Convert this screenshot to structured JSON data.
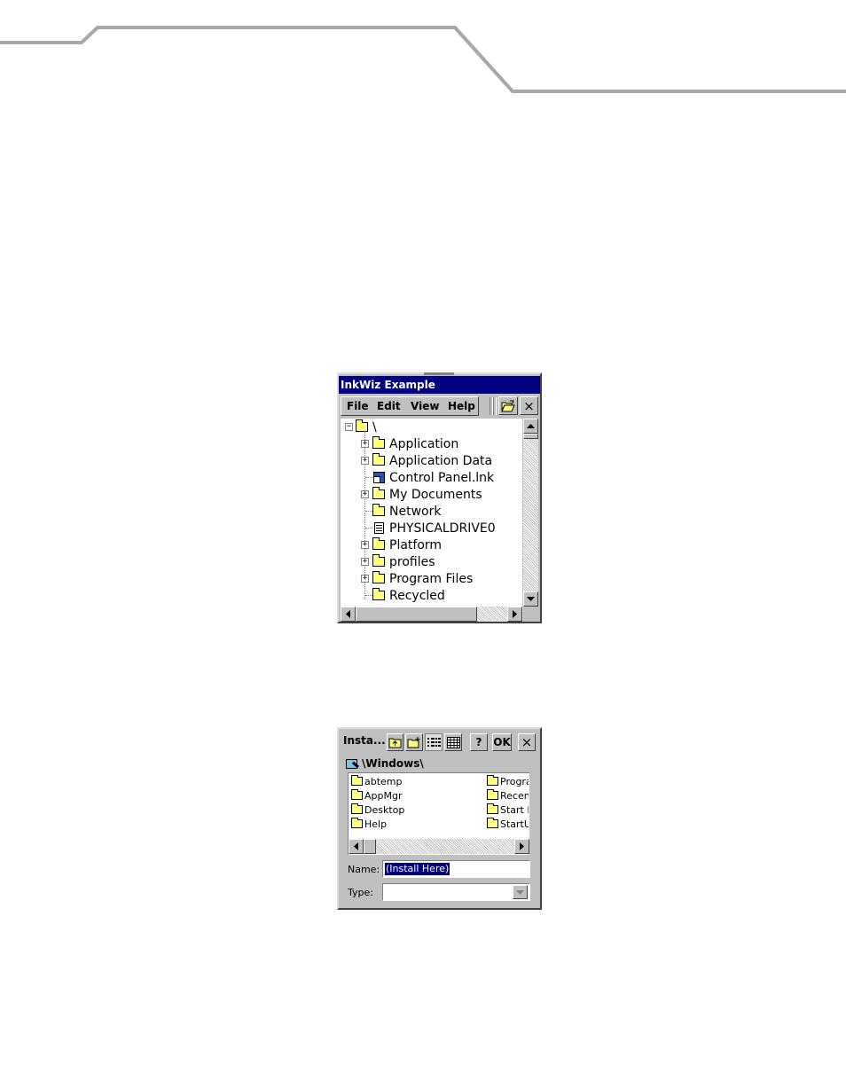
{
  "window1": {
    "title": "InkWiz Example",
    "menu": [
      "File",
      "Edit",
      "View",
      "Help"
    ],
    "tree": {
      "root": "\\",
      "items": [
        {
          "label": "Application",
          "icon": "folder-icon",
          "expandable": true
        },
        {
          "label": "Application Data",
          "icon": "folder-icon",
          "expandable": true
        },
        {
          "label": "Control Panel.lnk",
          "icon": "shortcut-icon",
          "expandable": false
        },
        {
          "label": "My Documents",
          "icon": "folder-icon",
          "expandable": true
        },
        {
          "label": "Network",
          "icon": "folder-icon",
          "expandable": false
        },
        {
          "label": "PHYSICALDRIVE0",
          "icon": "document-icon",
          "expandable": false
        },
        {
          "label": "Platform",
          "icon": "folder-icon",
          "expandable": true
        },
        {
          "label": "profiles",
          "icon": "folder-icon",
          "expandable": true
        },
        {
          "label": "Program Files",
          "icon": "folder-icon",
          "expandable": true
        },
        {
          "label": "Recycled",
          "icon": "folder-icon",
          "expandable": false
        }
      ]
    },
    "close_glyph": "×"
  },
  "window2": {
    "title": "Insta...",
    "help_label": "?",
    "ok_label": "OK",
    "close_glyph": "×",
    "path": "\\Windows\\",
    "files_col1": [
      "abtemp",
      "AppMgr",
      "Desktop",
      "Help"
    ],
    "files_col2": [
      "Progra",
      "Recen",
      "Start I",
      "StartU"
    ],
    "name_label": "Name:",
    "name_value": "(Install Here)",
    "type_label": "Type:",
    "type_value": ""
  }
}
